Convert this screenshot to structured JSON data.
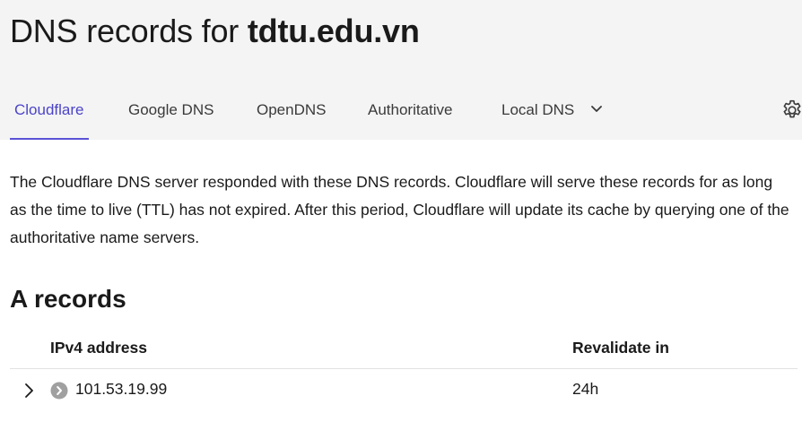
{
  "header": {
    "title_prefix": "DNS records for",
    "domain": "tdtu.edu.vn"
  },
  "tabs": [
    {
      "label": "Cloudflare",
      "active": true
    },
    {
      "label": "Google DNS",
      "active": false
    },
    {
      "label": "OpenDNS",
      "active": false
    },
    {
      "label": "Authoritative",
      "active": false
    },
    {
      "label": "Local DNS",
      "active": false,
      "has_dropdown": true
    }
  ],
  "settings_icon": "gear-icon",
  "description": "The Cloudflare DNS server responded with these DNS records. Cloudflare will serve these records for as long as the time to live (TTL) has not expired. After this period, Cloudflare will update its cache by querying one of the authoritative name servers.",
  "a_records": {
    "title": "A records",
    "columns": [
      "IPv4 address",
      "Revalidate in"
    ],
    "rows": [
      {
        "ip": "101.53.19.99",
        "revalidate": "24h"
      }
    ]
  },
  "colors": {
    "accent": "#5b52d6",
    "header_bg": "#f4f4f5"
  }
}
